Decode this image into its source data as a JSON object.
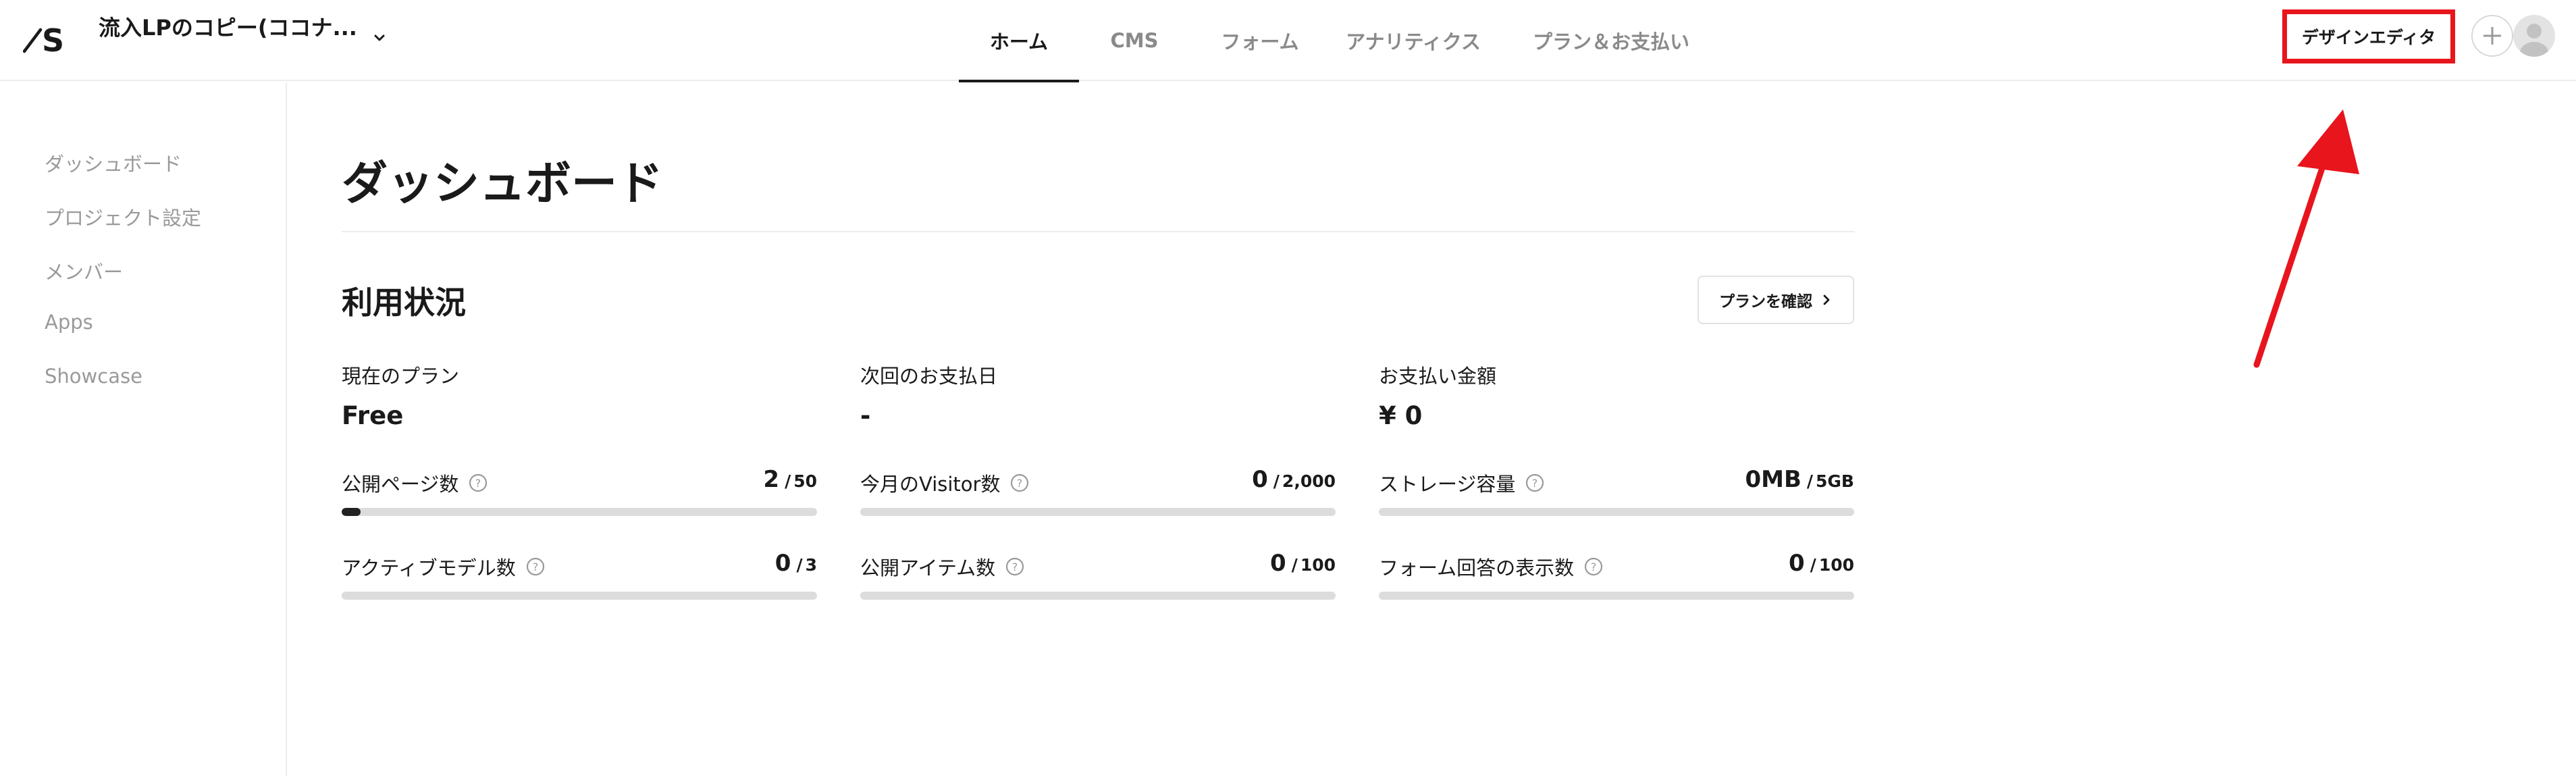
{
  "header": {
    "project_name": "流入LPのコピー(ココナ...",
    "tabs": [
      {
        "label": "ホーム",
        "active": true
      },
      {
        "label": "CMS",
        "active": false
      },
      {
        "label": "フォーム",
        "active": false
      },
      {
        "label": "アナリティクス",
        "active": false
      },
      {
        "label": "プラン＆お支払い",
        "active": false
      }
    ],
    "editor_button": "デザインエディタ"
  },
  "sidebar": {
    "items": [
      {
        "label": "ダッシュボード"
      },
      {
        "label": "プロジェクト設定"
      },
      {
        "label": "メンバー"
      },
      {
        "label": "Apps"
      },
      {
        "label": "Showcase"
      }
    ]
  },
  "main": {
    "title": "ダッシュボード",
    "usage": {
      "title": "利用状況",
      "plan_button": "プランを確認",
      "info": [
        {
          "label": "現在のプラン",
          "value": "Free"
        },
        {
          "label": "次回のお支払日",
          "value": "-"
        },
        {
          "label": "お支払い金額",
          "value": "¥ 0"
        }
      ],
      "metrics": [
        {
          "label": "公開ページ数",
          "current": "2",
          "sep": "/",
          "max": "50",
          "fraction": 0.04
        },
        {
          "label": "今月のVisitor数",
          "current": "0",
          "sep": "/",
          "max": "2,000",
          "fraction": 0
        },
        {
          "label": "ストレージ容量",
          "current": "0MB",
          "sep": "/",
          "max": "5GB",
          "fraction": 0
        },
        {
          "label": "アクティブモデル数",
          "current": "0",
          "sep": "/",
          "max": "3",
          "fraction": 0
        },
        {
          "label": "公開アイテム数",
          "current": "0",
          "sep": "/",
          "max": "100",
          "fraction": 0
        },
        {
          "label": "フォーム回答の表示数",
          "current": "0",
          "sep": "/",
          "max": "100",
          "fraction": 0
        }
      ]
    }
  },
  "colors": {
    "highlight_box": "#e8151d",
    "arrow": "#e8151d",
    "bar_fill": "#222222",
    "bar_track": "#dcdcdc"
  }
}
